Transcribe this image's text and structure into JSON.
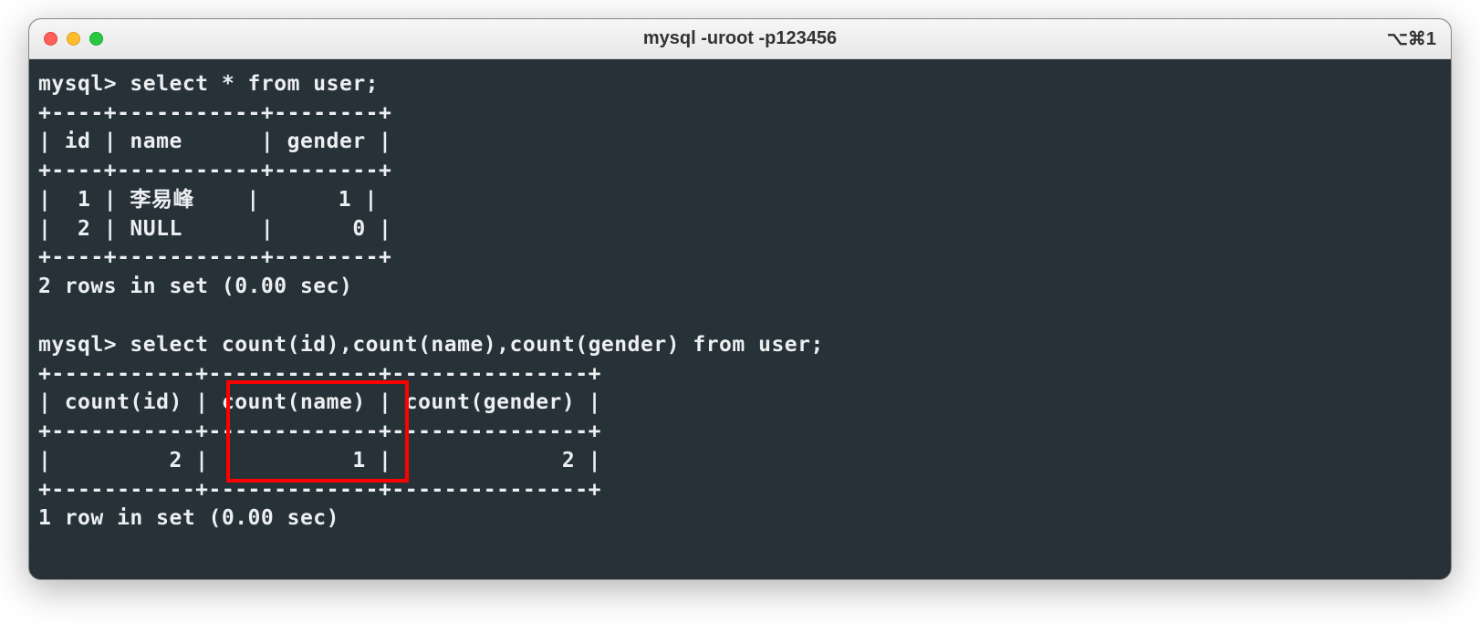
{
  "window": {
    "title": "mysql -uroot -p123456",
    "shortcut": "⌥⌘1"
  },
  "terminal": {
    "lines": [
      "mysql> select * from user;",
      "+----+-----------+--------+",
      "| id | name      | gender |",
      "+----+-----------+--------+",
      "|  1 | 李易峰    |      1 |",
      "|  2 | NULL      |      0 |",
      "+----+-----------+--------+",
      "2 rows in set (0.00 sec)",
      "",
      "mysql> select count(id),count(name),count(gender) from user;",
      "+-----------+-------------+---------------+",
      "| count(id) | count(name) | count(gender) |",
      "+-----------+-------------+---------------+",
      "|         2 |           1 |             2 |",
      "+-----------+-------------+---------------+",
      "1 row in set (0.00 sec)"
    ]
  },
  "query1": {
    "sql": "select * from user;",
    "columns": [
      "id",
      "name",
      "gender"
    ],
    "rows": [
      {
        "id": 1,
        "name": "李易峰",
        "gender": 1
      },
      {
        "id": 2,
        "name": null,
        "gender": 0
      }
    ],
    "status": "2 rows in set (0.00 sec)"
  },
  "query2": {
    "sql": "select count(id),count(name),count(gender) from user;",
    "columns": [
      "count(id)",
      "count(name)",
      "count(gender)"
    ],
    "rows": [
      {
        "count(id)": 2,
        "count(name)": 1,
        "count(gender)": 2
      }
    ],
    "status": "1 row in set (0.00 sec)"
  },
  "highlight": {
    "column": "count(name)",
    "value": 1
  }
}
